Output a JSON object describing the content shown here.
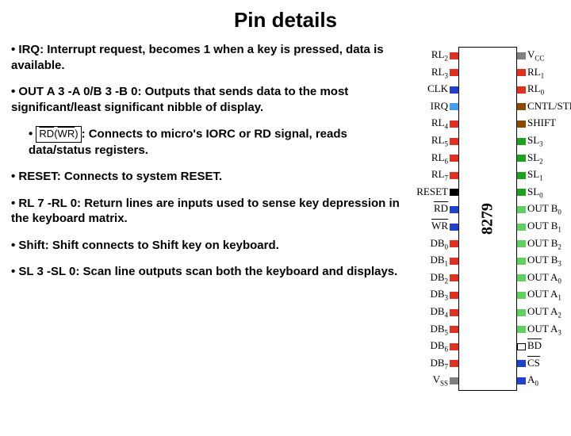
{
  "title": "Pin details",
  "bullets": {
    "irq": "• IRQ: Interrupt request, becomes 1 when a key is pressed, data is available.",
    "out": "• OUT A 3 -A 0/B 3 -B 0: Outputs that sends data to the most significant/least significant nibble of display.",
    "rdwr_pre": "• ",
    "rdwr_box1": "RD",
    "rdwr_box2": "WR",
    "rdwr_post": ":   Connects to micro's IORC or RD signal, reads data/status registers.",
    "reset": "• RESET: Connects to system RESET.",
    "rl": "• RL 7 -RL 0: Return lines are inputs used to sense key depression in the keyboard matrix.",
    "shift": "• Shift: Shift connects to Shift key on keyboard.",
    "sl": "• SL 3 -SL 0: Scan line outputs scan both the keyboard and displays."
  },
  "chip": {
    "label": "8279",
    "left_pins": [
      {
        "t": "RL",
        "s": "2",
        "c": "pm-red",
        "ov": false
      },
      {
        "t": "RL",
        "s": "3",
        "c": "pm-red",
        "ov": false
      },
      {
        "t": "CLK",
        "s": "",
        "c": "pm-blue",
        "ov": false
      },
      {
        "t": "IRQ",
        "s": "",
        "c": "pm-lblue",
        "ov": false
      },
      {
        "t": "RL",
        "s": "4",
        "c": "pm-red",
        "ov": false
      },
      {
        "t": "RL",
        "s": "5",
        "c": "pm-red",
        "ov": false
      },
      {
        "t": "RL",
        "s": "6",
        "c": "pm-red",
        "ov": false
      },
      {
        "t": "RL",
        "s": "7",
        "c": "pm-red",
        "ov": false
      },
      {
        "t": "RESET",
        "s": "",
        "c": "pm-black",
        "ov": false
      },
      {
        "t": "RD",
        "s": "",
        "c": "pm-blue",
        "ov": true
      },
      {
        "t": "WR",
        "s": "",
        "c": "pm-blue",
        "ov": true
      },
      {
        "t": "DB",
        "s": "0",
        "c": "pm-red",
        "ov": false
      },
      {
        "t": "DB",
        "s": "1",
        "c": "pm-red",
        "ov": false
      },
      {
        "t": "DB",
        "s": "2",
        "c": "pm-red",
        "ov": false
      },
      {
        "t": "DB",
        "s": "3",
        "c": "pm-red",
        "ov": false
      },
      {
        "t": "DB",
        "s": "4",
        "c": "pm-red",
        "ov": false
      },
      {
        "t": "DB",
        "s": "5",
        "c": "pm-red",
        "ov": false
      },
      {
        "t": "DB",
        "s": "6",
        "c": "pm-red",
        "ov": false
      },
      {
        "t": "DB",
        "s": "7",
        "c": "pm-red",
        "ov": false
      },
      {
        "t": "V",
        "s": "SS",
        "c": "pm-gray",
        "ov": false
      }
    ],
    "right_pins": [
      {
        "t": "V",
        "s": "CC",
        "c": "pm-gray",
        "ov": false
      },
      {
        "t": "RL",
        "s": "1",
        "c": "pm-red",
        "ov": false
      },
      {
        "t": "RL",
        "s": "0",
        "c": "pm-red",
        "ov": false
      },
      {
        "t": "CNTL/STB",
        "s": "",
        "c": "pm-brown",
        "ov": false
      },
      {
        "t": "SHIFT",
        "s": "",
        "c": "pm-brown",
        "ov": false
      },
      {
        "t": "SL",
        "s": "3",
        "c": "pm-green",
        "ov": false
      },
      {
        "t": "SL",
        "s": "2",
        "c": "pm-green",
        "ov": false
      },
      {
        "t": "SL",
        "s": "1",
        "c": "pm-green",
        "ov": false
      },
      {
        "t": "SL",
        "s": "0",
        "c": "pm-green",
        "ov": false
      },
      {
        "t": "OUT B",
        "s": "0",
        "c": "pm-lgreen",
        "ov": false
      },
      {
        "t": "OUT B",
        "s": "1",
        "c": "pm-lgreen",
        "ov": false
      },
      {
        "t": "OUT B",
        "s": "2",
        "c": "pm-lgreen",
        "ov": false
      },
      {
        "t": "OUT B",
        "s": "3",
        "c": "pm-lgreen",
        "ov": false
      },
      {
        "t": "OUT A",
        "s": "0",
        "c": "pm-lgreen",
        "ov": false
      },
      {
        "t": "OUT A",
        "s": "1",
        "c": "pm-lgreen",
        "ov": false
      },
      {
        "t": "OUT A",
        "s": "2",
        "c": "pm-lgreen",
        "ov": false
      },
      {
        "t": "OUT A",
        "s": "3",
        "c": "pm-lgreen",
        "ov": false
      },
      {
        "t": "BD",
        "s": "",
        "c": "pm-white",
        "ov": true
      },
      {
        "t": "CS",
        "s": "",
        "c": "pm-blue",
        "ov": true
      },
      {
        "t": "A",
        "s": "0",
        "c": "pm-blue",
        "ov": false
      }
    ]
  }
}
